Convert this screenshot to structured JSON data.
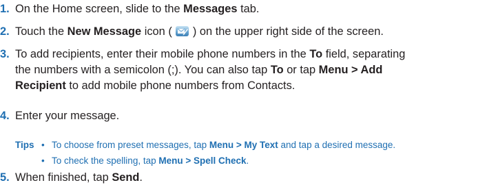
{
  "colors": {
    "accent": "#1f6fb2",
    "text": "#231f20"
  },
  "steps": [
    {
      "num": "1.",
      "pre": "On the Home screen, slide to the ",
      "bold": "Messages",
      "post": " tab."
    },
    {
      "num": "2.",
      "pre": "Touch the ",
      "bold": "New Message",
      "mid": " icon ( ",
      "icon": "new-message-icon",
      "post": " ) on the upper right side of the screen."
    },
    {
      "num": "3.",
      "line1_pre": "To add recipients, enter their mobile phone numbers in the ",
      "line1_bold": "To",
      "line1_post": " field, separating",
      "line2_pre": "the numbers with a semicolon (;). You can also tap ",
      "line2_bold1": "To",
      "line2_mid": " or tap ",
      "line2_bold2": "Menu > Add",
      "line3_bold": "Recipient",
      "line3_post": " to add mobile phone numbers from Contacts."
    },
    {
      "num": "4.",
      "text": "Enter your message."
    },
    {
      "num": "5.",
      "pre": "When finished, tap ",
      "bold": "Send",
      "post": "."
    }
  ],
  "tips": {
    "label": "Tips",
    "bullet": "•",
    "items": [
      {
        "pre": "To choose from preset messages, tap ",
        "bold": "Menu > My Text",
        "post": " and tap a desired message."
      },
      {
        "pre": "To check the spelling, tap ",
        "bold": "Menu > Spell Check",
        "post": "."
      }
    ]
  }
}
